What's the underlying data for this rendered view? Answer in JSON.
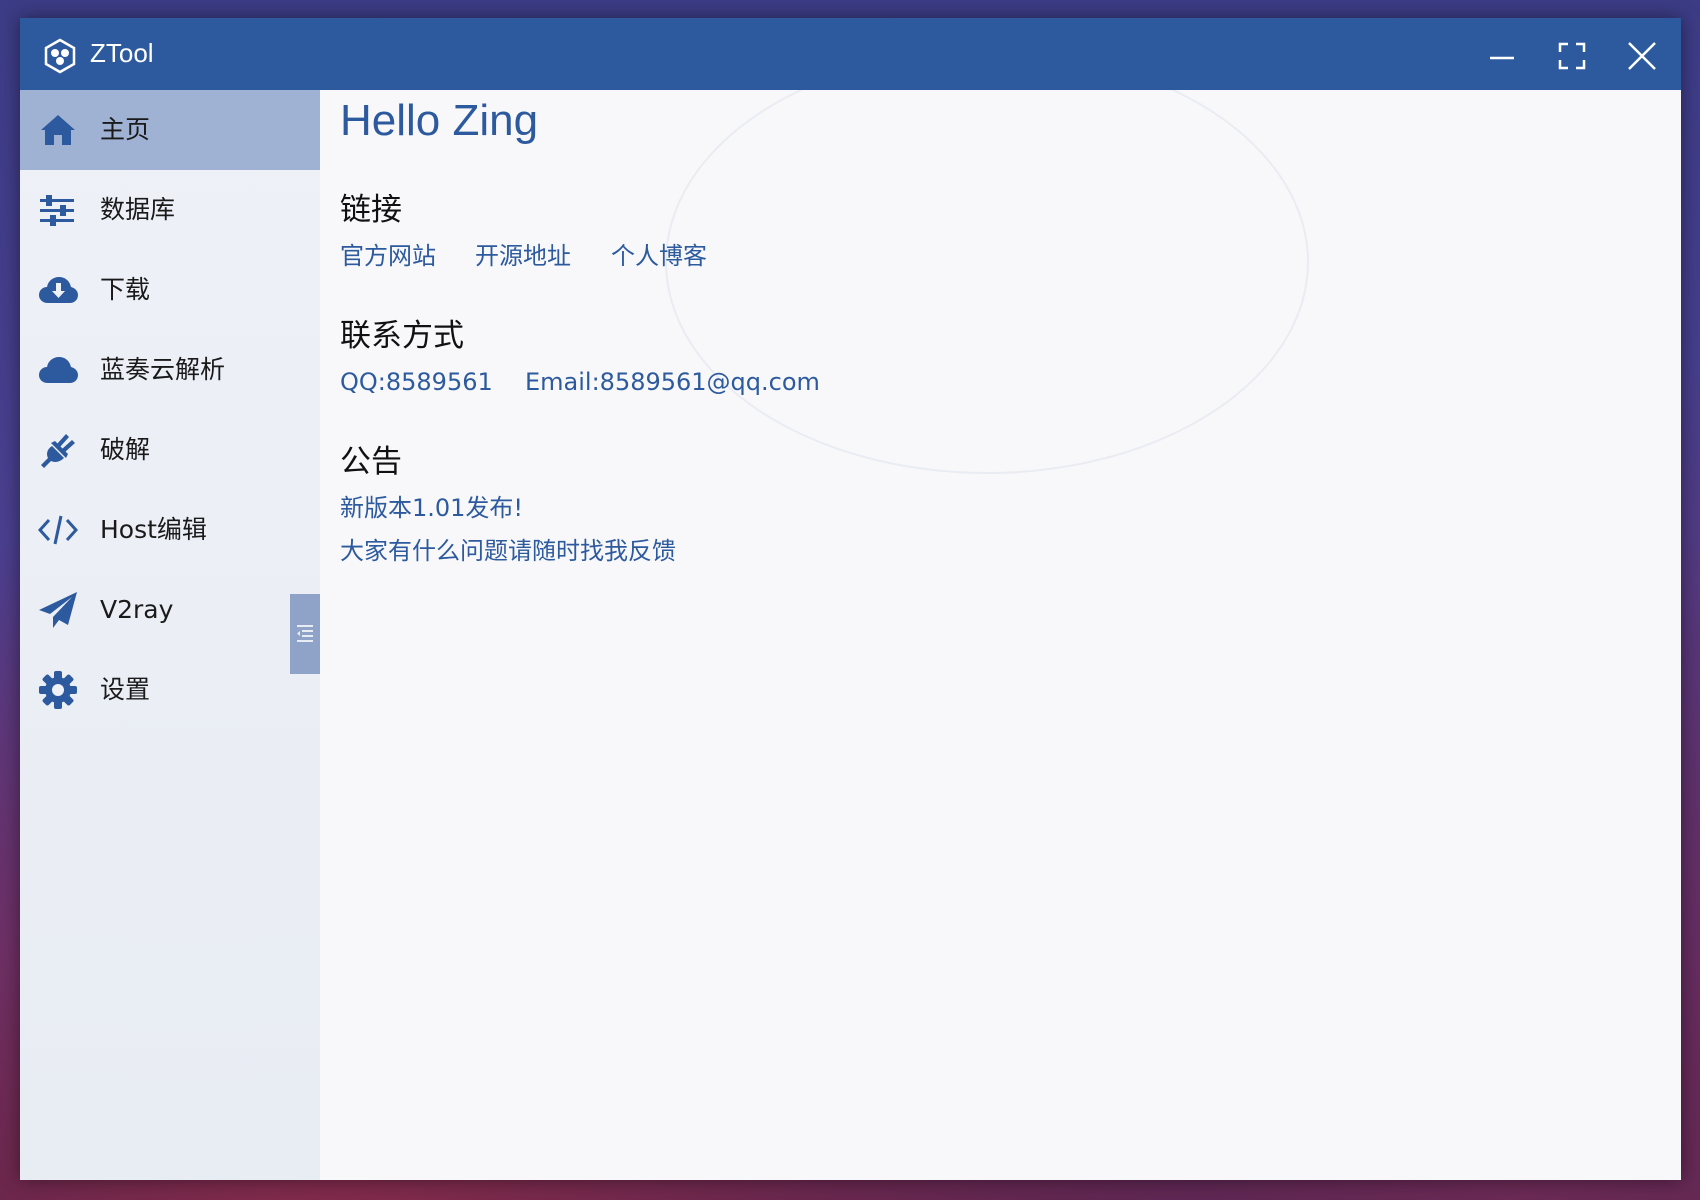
{
  "window": {
    "title": "ZTool",
    "accent_color": "#2d5a9e",
    "controls": {
      "minimize_icon": "minimize-icon",
      "maximize_icon": "maximize-icon",
      "close_icon": "close-icon"
    }
  },
  "sidebar": {
    "items": [
      {
        "label": "主页",
        "icon": "home-icon",
        "active": true
      },
      {
        "label": "数据库",
        "icon": "sliders-icon",
        "active": false
      },
      {
        "label": "下载",
        "icon": "cloud-download-icon",
        "active": false
      },
      {
        "label": "蓝奏云解析",
        "icon": "cloud-icon",
        "active": false
      },
      {
        "label": "破解",
        "icon": "plug-icon",
        "active": false
      },
      {
        "label": "Host编辑",
        "icon": "code-icon",
        "active": false
      },
      {
        "label": "V2ray",
        "icon": "paper-plane-icon",
        "active": false
      },
      {
        "label": "设置",
        "icon": "gear-icon",
        "active": false
      }
    ],
    "collapse_icon": "collapse-sidebar-icon"
  },
  "main": {
    "greeting": "Hello Zing",
    "links_section": {
      "title": "链接",
      "links": [
        "官方网站",
        "开源地址",
        "个人博客"
      ]
    },
    "contact_section": {
      "title": "联系方式",
      "qq": "QQ:8589561",
      "email": "Email:8589561@qq.com"
    },
    "notice_section": {
      "title": "公告",
      "lines": [
        "新版本1.01发布!",
        "大家有什么问题请随时找我反馈"
      ]
    }
  }
}
